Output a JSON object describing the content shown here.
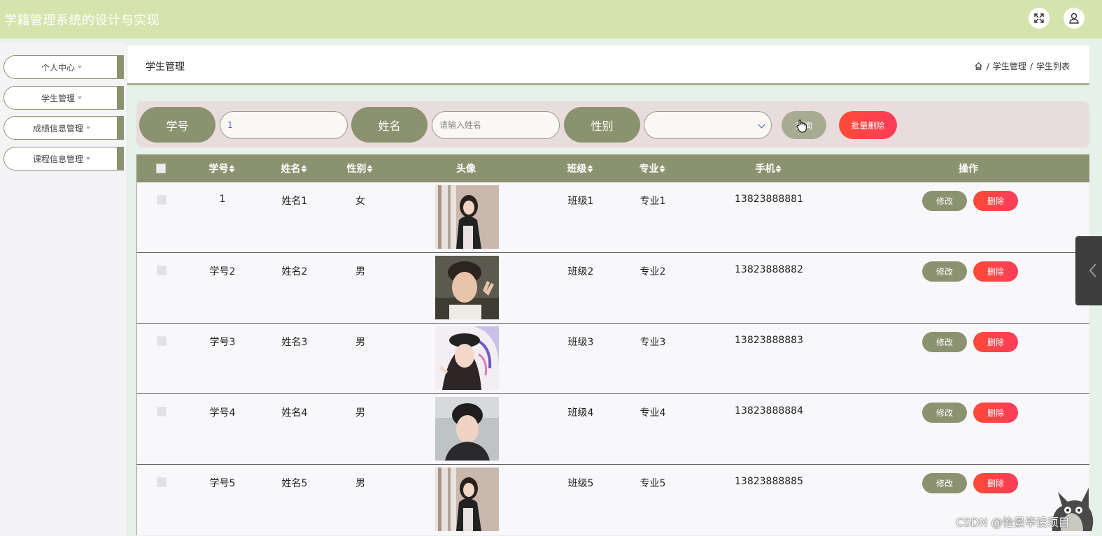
{
  "app": {
    "title": "学籍管理系统的设计与实现"
  },
  "topbar": {
    "icons": [
      "fullscreen-icon",
      "user-icon"
    ]
  },
  "sidebar": {
    "items": [
      {
        "label": "个人中心"
      },
      {
        "label": "学生管理"
      },
      {
        "label": "成绩信息管理"
      },
      {
        "label": "课程信息管理"
      }
    ]
  },
  "header": {
    "title": "学生管理",
    "breadcrumb": [
      "学生管理",
      "学生列表"
    ],
    "separator": "/"
  },
  "search": {
    "student_id_label": "学号",
    "student_id_value": "1",
    "name_label": "姓名",
    "name_placeholder": "请输入姓名",
    "gender_label": "性别",
    "gender_value": "",
    "query_button": "查询",
    "batch_delete_button": "批量删除"
  },
  "table": {
    "headers": {
      "student_id": "学号",
      "name": "姓名",
      "gender": "性别",
      "avatar": "头像",
      "class": "班级",
      "major": "专业",
      "phone": "手机",
      "actions": "操作"
    },
    "rows": [
      {
        "student_id": "1",
        "name": "姓名1",
        "gender": "女",
        "class": "班级1",
        "major": "专业1",
        "phone": "13823888881"
      },
      {
        "student_id": "学号2",
        "name": "姓名2",
        "gender": "男",
        "class": "班级2",
        "major": "专业2",
        "phone": "13823888882"
      },
      {
        "student_id": "学号3",
        "name": "姓名3",
        "gender": "男",
        "class": "班级3",
        "major": "专业3",
        "phone": "13823888883"
      },
      {
        "student_id": "学号4",
        "name": "姓名4",
        "gender": "男",
        "class": "班级4",
        "major": "专业4",
        "phone": "13823888884"
      },
      {
        "student_id": "学号5",
        "name": "姓名5",
        "gender": "男",
        "class": "班级5",
        "major": "专业5",
        "phone": "13823888885"
      }
    ],
    "edit_label": "修改",
    "delete_label": "删除"
  },
  "watermark": "CSDN @怡景毕设项目",
  "colors": {
    "topbar": "#d5e4ad",
    "accent": "#8b926f",
    "danger": "#ff4a35",
    "search_bg": "#e8dcdc"
  }
}
